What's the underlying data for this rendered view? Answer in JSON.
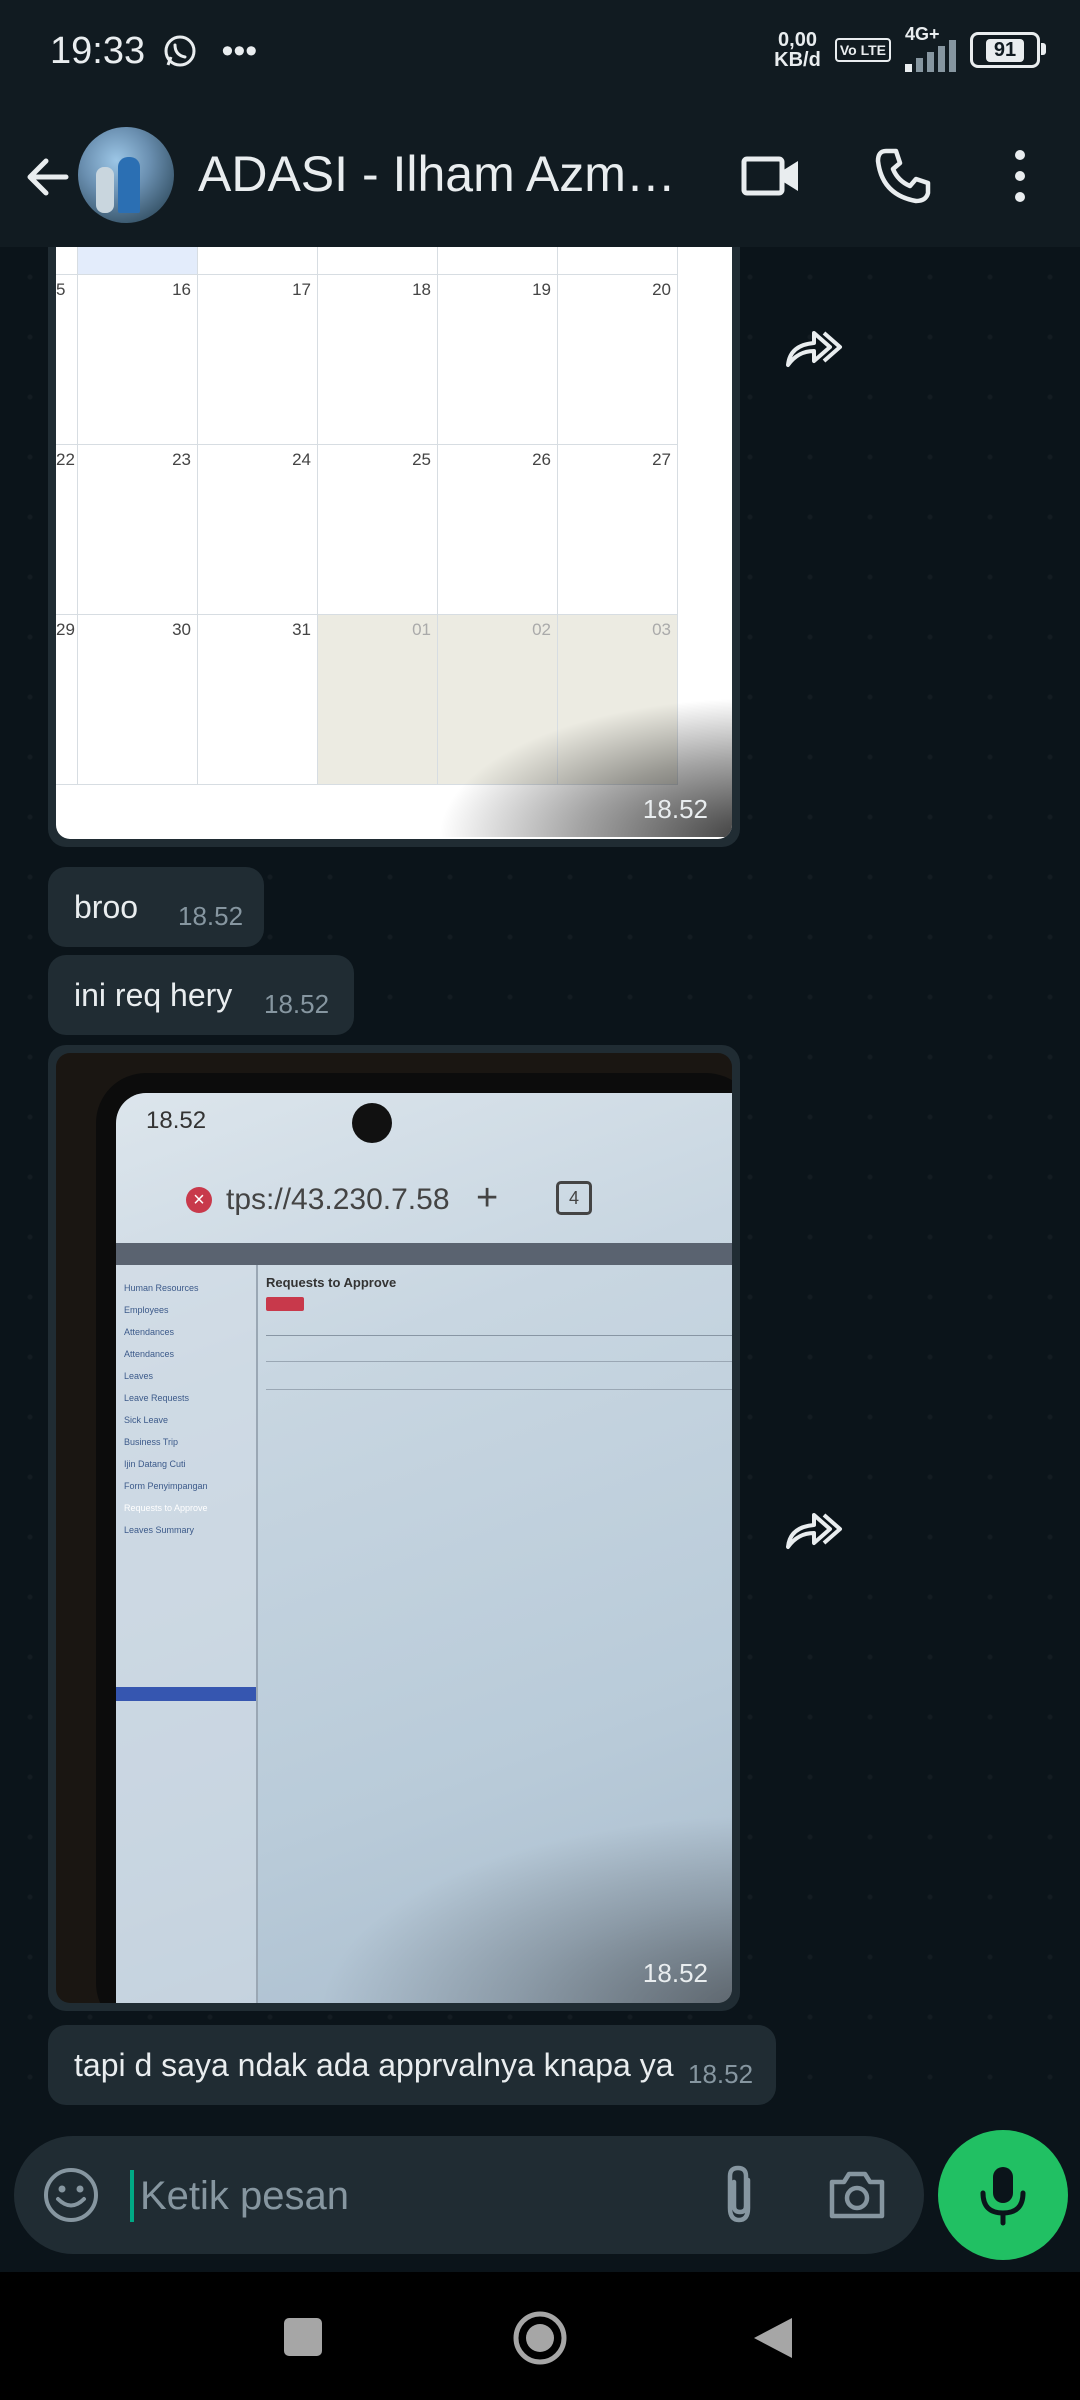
{
  "status_bar": {
    "time": "19:33",
    "left_icons": "whatsapp-icon more-dots-icon",
    "net_speed_top": "0,00",
    "net_speed_bottom": "KB/d",
    "volte": "Vo LTE",
    "network": "4G+",
    "battery": "91"
  },
  "header": {
    "title": "ADASI - Ilham Azmy...",
    "icons": [
      "back-arrow-icon",
      "video-call-icon",
      "voice-call-icon",
      "more-options-icon"
    ]
  },
  "calendar_image": {
    "rows": [
      [
        "5",
        "16",
        "17",
        "18",
        "19",
        "20"
      ],
      [
        "22",
        "23",
        "24",
        "25",
        "26",
        "27"
      ],
      [
        "29",
        "30",
        "31",
        "01",
        "02",
        "03"
      ]
    ],
    "time": "18.52"
  },
  "messages": [
    {
      "text": "broo",
      "time": "18.52"
    },
    {
      "text": "ini req hery",
      "time": "18.52"
    },
    {
      "text": "tapi d saya ndak ada apprvalnya knapa ya",
      "time": "18.52"
    }
  ],
  "photo_image": {
    "phone_status_time": "18.52",
    "url": "tps://43.230.7.58",
    "tab_count": "4",
    "page_title": "Requests to Approve",
    "sidebar_items": [
      "Human Resources",
      "Employees",
      "Attendances",
      "Attendances",
      "Leaves",
      "Leave Requests",
      "Sick Leave",
      "Business Trip",
      "Ijin Datang Cuti",
      "Form Penyimpangan",
      "Requests to Approve",
      "Leaves Summary"
    ],
    "time": "18.52"
  },
  "composer": {
    "placeholder": "Ketik pesan",
    "value": ""
  },
  "colors": {
    "background": "#0b141a",
    "bubble": "#202c33",
    "accent": "#21c063"
  }
}
